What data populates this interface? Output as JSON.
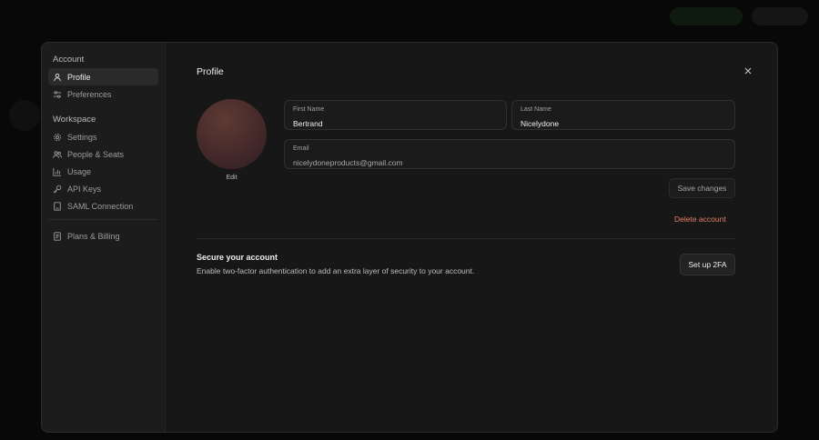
{
  "sidebar": {
    "account_heading": "Account",
    "workspace_heading": "Workspace",
    "items": [
      {
        "label": "Profile",
        "icon": "user-icon"
      },
      {
        "label": "Preferences",
        "icon": "sliders-icon"
      },
      {
        "label": "Settings",
        "icon": "gear-icon"
      },
      {
        "label": "People & Seats",
        "icon": "users-icon"
      },
      {
        "label": "Usage",
        "icon": "bar-chart-icon"
      },
      {
        "label": "API Keys",
        "icon": "key-icon"
      },
      {
        "label": "SAML Connection",
        "icon": "document-icon"
      },
      {
        "label": "Plans & Billing",
        "icon": "receipt-icon"
      }
    ],
    "active": "Profile"
  },
  "profile": {
    "title": "Profile",
    "avatar_edit": "Edit",
    "first_name": {
      "label": "First Name",
      "value": "Bertrand"
    },
    "last_name": {
      "label": "Last Name",
      "value": "Nicelydone"
    },
    "email": {
      "label": "Email",
      "value": "nicelydoneproducts@gmail.com"
    },
    "save_label": "Save changes",
    "delete_label": "Delete account"
  },
  "security": {
    "title": "Secure your account",
    "description": "Enable two-factor authentication to add an extra layer of security to your account.",
    "button_label": "Set up 2FA"
  },
  "colors": {
    "danger": "#e4806a",
    "modal_bg": "#171717",
    "sidebar_bg": "#1c1c1c"
  }
}
